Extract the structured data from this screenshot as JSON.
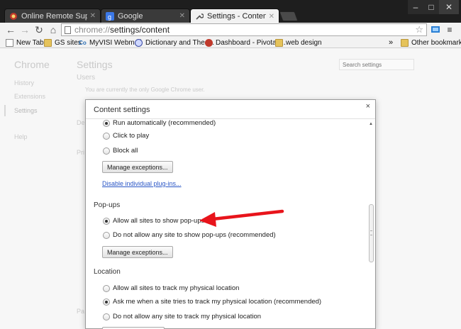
{
  "tabs": [
    {
      "label": "Online Remote Support - ",
      "icon": "remote-support-icon"
    },
    {
      "label": "Google",
      "icon": "google-icon"
    },
    {
      "label": "Settings - Content settings",
      "icon": "wrench-icon"
    }
  ],
  "toolbar": {
    "url_scheme": "chrome://",
    "url_path": "settings/content"
  },
  "bookmarks": [
    {
      "label": "New Tab",
      "icon": "page-icon"
    },
    {
      "label": "GS sites",
      "icon": "folder-icon"
    },
    {
      "label": "MyVISI Webmail",
      "icon": "webmail-icon"
    },
    {
      "label": "Dictionary and Thes...",
      "icon": "dictionary-icon"
    },
    {
      "label": "Dashboard - Pivotal ...",
      "icon": "pivotal-icon"
    },
    {
      "label": "web design",
      "icon": "folder-icon"
    }
  ],
  "bookmarks_overflow": "»",
  "other_bookmarks": "Other bookmarks",
  "background": {
    "sidebar_title": "Chrome",
    "sidebar_items": [
      "History",
      "Extensions",
      "Settings",
      "Help"
    ],
    "settings_title": "Settings",
    "search_placeholder": "Search settings",
    "users_label": "Users",
    "users_text": "You are currently the only Google Chrome user.",
    "frag_de": "De",
    "frag_pri": "Pri",
    "frag_pa": "Pa"
  },
  "dialog": {
    "title": "Content settings",
    "close": "×",
    "plugins": {
      "options": [
        {
          "label": "Run automatically (recommended)",
          "selected": true
        },
        {
          "label": "Click to play",
          "selected": false
        },
        {
          "label": "Block all",
          "selected": false
        }
      ],
      "manage_button": "Manage exceptions...",
      "disable_link": "Disable individual plug-ins..."
    },
    "popups": {
      "heading": "Pop-ups",
      "options": [
        {
          "label": "Allow all sites to show pop-ups",
          "selected": true
        },
        {
          "label": "Do not allow any site to show pop-ups (recommended)",
          "selected": false
        }
      ],
      "manage_button": "Manage exceptions..."
    },
    "location": {
      "heading": "Location",
      "options": [
        {
          "label": "Allow all sites to track my physical location",
          "selected": false
        },
        {
          "label": "Ask me when a site tries to track my physical location (recommended)",
          "selected": true
        },
        {
          "label": "Do not allow any site to track my physical location",
          "selected": false
        }
      ]
    }
  },
  "colors": {
    "annotation_arrow": "#e8141b",
    "link": "#2a56c6"
  }
}
